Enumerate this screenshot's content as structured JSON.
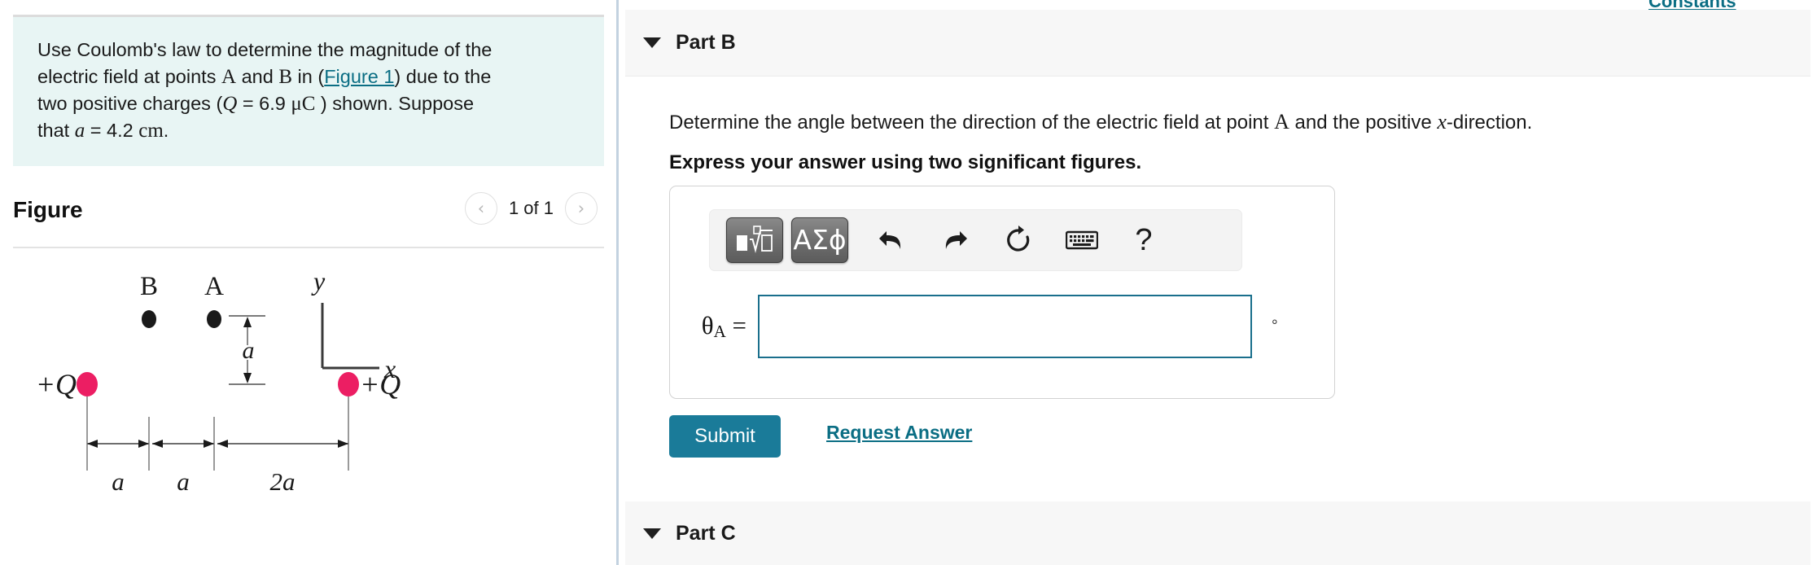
{
  "problem": {
    "sentence_1": "Use Coulomb's law to determine the magnitude of the",
    "sentence_2_a": "electric field at points",
    "pointA": "A",
    "and": "and",
    "pointB": "B",
    "in": "in (",
    "figure_link": "Figure 1",
    "after_link": ") due to the",
    "sentence_3_a": "two positive charges (",
    "Q": "Q",
    "eq_value": " = 6.9 ",
    "unit_uC": "μC",
    "sentence_3_b": " ) shown. Suppose",
    "sentence_4_a": "that ",
    "a_sym": "a",
    "a_value": " = 4.2 ",
    "unit_cm": "cm",
    "period": "."
  },
  "figure": {
    "title": "Figure",
    "prev_icon": "chevron-left-icon",
    "next_icon": "chevron-right-icon",
    "counter": "1 of 1",
    "labels": {
      "pointB": "B",
      "pointA": "A",
      "axis_y": "y",
      "axis_x": "x",
      "vertical_gap": "a",
      "charge_left": "+Q",
      "charge_right": "+Q",
      "dim_1": "a",
      "dim_2": "a",
      "dim_3": "2a"
    },
    "colors": {
      "charge_pink": "#ec1e63",
      "point_black": "#1a1a1a",
      "line_gray": "#6e6e6e",
      "box_background": "#e8f5f4"
    }
  },
  "right": {
    "constants_link": "Constants",
    "partB": {
      "caret_icon": "caret-down-icon",
      "label": "Part B",
      "question_a": "Determine the angle between the direction of the electric field at point ",
      "question_pointA": "A",
      "question_b": " and the positive ",
      "question_x": "x",
      "question_c": "-direction.",
      "express": "Express your answer using two significant figures."
    },
    "toolbar": {
      "math_template_icon": "math-template-icon",
      "greek_label": "ΑΣϕ",
      "greek_icon": "greek-letters-icon",
      "undo_icon": "undo-icon",
      "redo_icon": "redo-icon",
      "reset_icon": "reset-icon",
      "keyboard_icon": "keyboard-icon",
      "help_label": "?",
      "help_icon": "help-icon"
    },
    "answer": {
      "label_theta": "θ",
      "label_sub": "A",
      "label_eq": " =",
      "value": "",
      "placeholder": "",
      "unit": "°"
    },
    "submit_label": "Submit",
    "request_answer_label": "Request Answer",
    "partC": {
      "caret_icon": "caret-down-icon",
      "label": "Part C"
    },
    "colors": {
      "accent_teal": "#1a7b99",
      "link_teal": "#0b6e84",
      "header_bg": "#f7f7f7"
    }
  }
}
